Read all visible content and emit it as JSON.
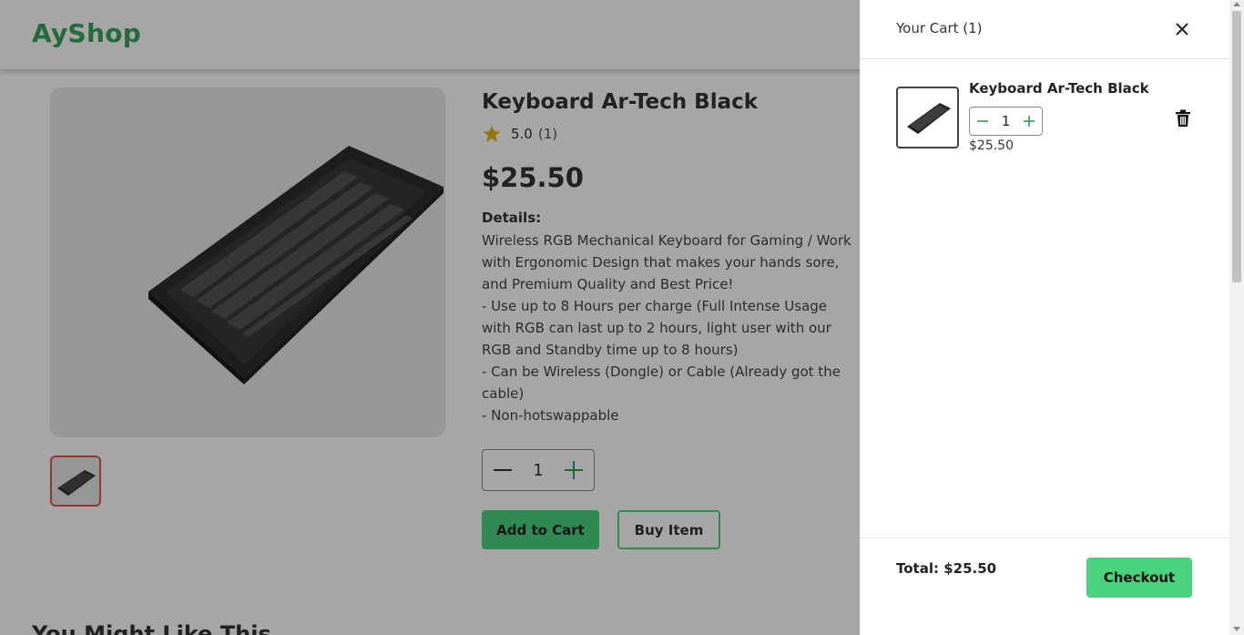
{
  "header": {
    "logo": "AyShop"
  },
  "product": {
    "title": "Keyboard Ar-Tech Black",
    "rating": "5.0",
    "rating_count": "(1)",
    "price": "$25.50",
    "details_label": "Details:",
    "details_text": "Wireless RGB Mechanical Keyboard for Gaming / Work with Ergonomic Design that makes your hands sore, and Premium Quality and Best Price!\n- Use up to 8 Hours per charge (Full Intense Usage with RGB can last up to 2 hours, light user with our RGB and Standby time up to 8 hours)\n- Can be Wireless (Dongle) or Cable (Already got the cable)\n- Non-hotswappable",
    "quantity": "1",
    "add_to_cart_label": "Add to Cart",
    "buy_item_label": "Buy Item"
  },
  "section": {
    "might_like_title": "You Might Like This"
  },
  "cart": {
    "title": "Your Cart (1)",
    "items": [
      {
        "name": "Keyboard Ar-Tech Black",
        "quantity": "1",
        "price": "$25.50"
      }
    ],
    "total": "Total: $25.50",
    "checkout_label": "Checkout"
  },
  "colors": {
    "brand_green": "#3aa35f",
    "button_green": "#4bd27f",
    "star": "#e6b417",
    "thumb_border": "#e05252"
  },
  "icons": [
    "star-icon",
    "minus-icon",
    "plus-icon",
    "close-icon",
    "trash-icon",
    "keyboard-image"
  ]
}
